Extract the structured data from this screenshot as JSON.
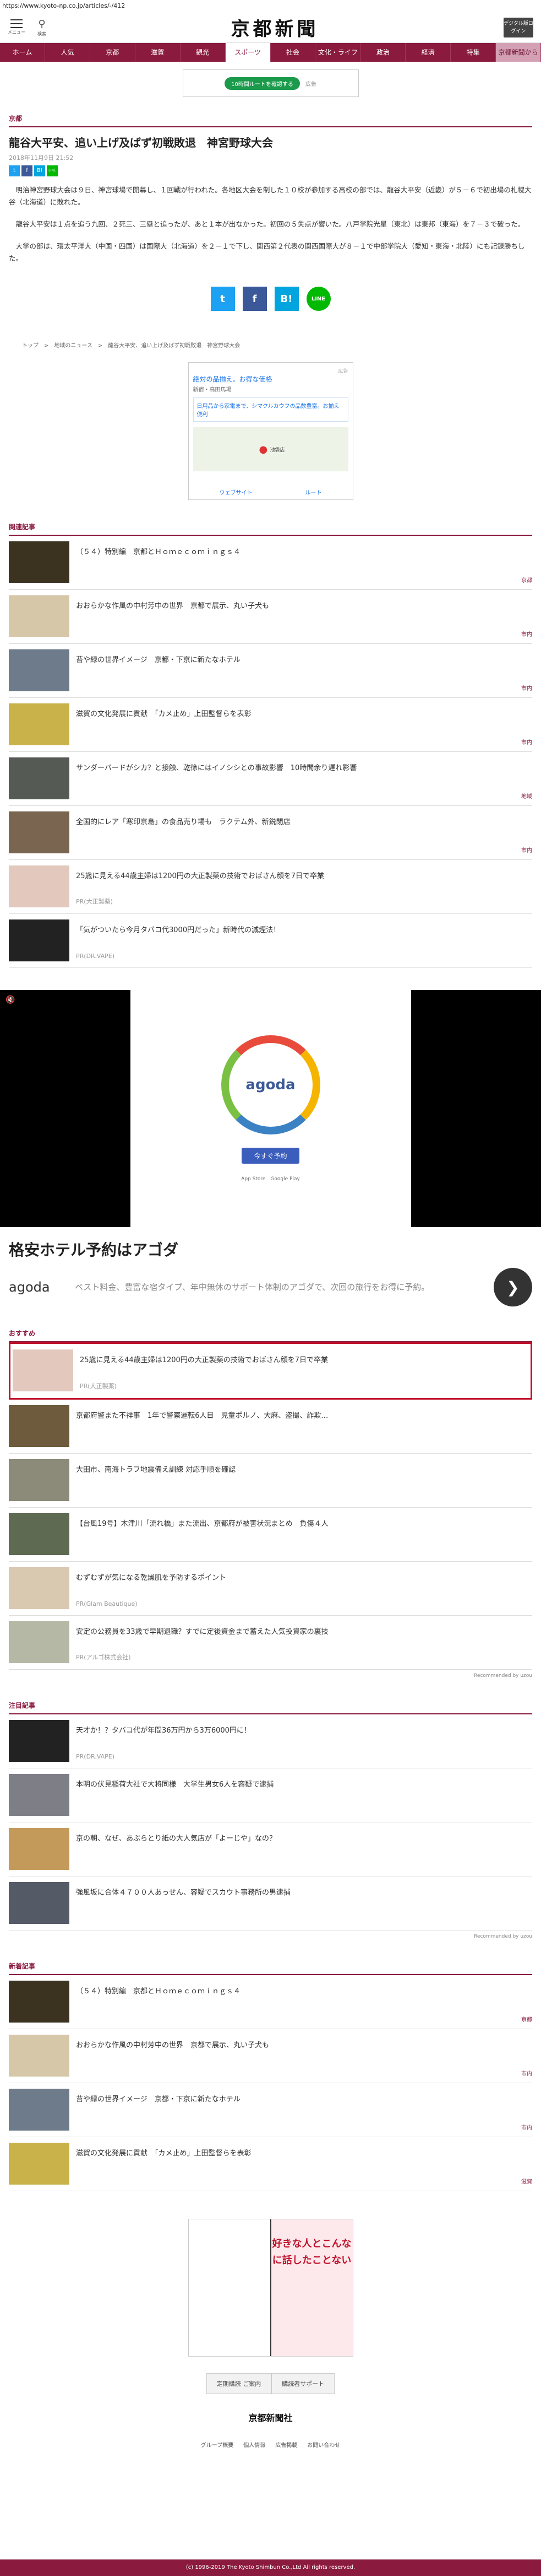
{
  "browser": {
    "url": "https://www.kyoto-np.co.jp/articles/-/412"
  },
  "header": {
    "menu_label": "メニュー",
    "search_label": "検索",
    "logo": "京都新聞",
    "digital_label": "デジタル版ログイン"
  },
  "nav": [
    "ホーム",
    "人気",
    "京都",
    "滋賀",
    "観光",
    "スポーツ",
    "社会",
    "文化・ライフ",
    "政治",
    "経済",
    "特集",
    "京都新聞から"
  ],
  "top_ad": {
    "pill": "10時間ルートを確認する",
    "label": "広告"
  },
  "article": {
    "category": "京都",
    "title": "龍谷大平安、追い上げ及ばず初戦敗退　神宮野球大会",
    "date": "2018年11月9日 21:52",
    "paragraphs": [
      "明治神宮野球大会は９日、神宮球場で開幕し、１回戦が行われた。各地区大会を制した１０校が参加する高校の部では、龍谷大平安（近畿）が５－６で初出場の札幌大谷（北海道）に敗れた。",
      "龍谷大平安は１点を追う九回、２死三、三塁と追ったが、あと１本が出なかった。初回の５失点が響いた。八戸学院光星（東北）は東邦（東海）を７－３で破った。",
      "大学の部は、環太平洋大（中国・四国）は国際大（北海道）を２－１で下し、関西第２代表の関西国際大が８－１で中部学院大（愛知・東海・北陸）にも記録勝ちした。"
    ],
    "share": {
      "twitter": "t",
      "facebook": "f",
      "hatena": "B!",
      "line": "LINE"
    },
    "breadcrumb": "トップ　>　地域のニュース　>　龍谷大平安、追い上げ及ばず初戦敗退　神宮野球大会"
  },
  "map_ad": {
    "label": "広告",
    "title": "絶対の品揃え。お得な価格",
    "sub": "新宿・高田馬場",
    "body": "日用品から家電まで、シマクルカウフの品数豊富。お揃え便利",
    "pin_label": "池袋店",
    "route": "ルート",
    "website": "ウェブサイト"
  },
  "related": {
    "title": "関連記事",
    "items": [
      {
        "title": "（５４）特別編　京都とＨｏｍｅｃｏｍｉｎｇｓ４",
        "tag": "京都"
      },
      {
        "title": "おおらかな作風の中村芳中の世界　京都で展示、丸い子犬も",
        "tag": "市内"
      },
      {
        "title": "苔や緑の世界イメージ　京都・下京に新たなホテル",
        "tag": "市内"
      },
      {
        "title": "滋賀の文化発展に貢献　「カメ止め」上田監督らを表彰",
        "tag": "市内"
      },
      {
        "title": "サンダーバードがシカ？と接触、乾徐にはイノシシとの事故影響　10時間余り遅れ影響",
        "tag": "地域"
      },
      {
        "title": "全国的にレア「寒印京島」の食品売り場も　ラクテム外、新鋭閉店",
        "tag": "市内"
      },
      {
        "title": "25歳に見える44歳主婦は1200円の大正製薬の技術でおばさん顔を7日で卒業",
        "sponsor": "PR(大正製薬)"
      },
      {
        "title": "「気がついたら今月タバコ代3000円だった」新時代の減煙法！",
        "sponsor": "PR(DR.VAPE)"
      }
    ]
  },
  "video_ad": {
    "brand": "agoda",
    "cta": "今すぐ予約",
    "stores": "App Store　Google Play",
    "headline": "格安ホテル予約はアゴダ",
    "description": "ベスト料金、豊富な宿タイプ、年中無休のサポート体制のアゴダで、次回の旅行をお得に予約。"
  },
  "recommend": {
    "title": "おすすめ",
    "items": [
      {
        "title": "25歳に見える44歳主婦は1200円の大正製薬の技術でおばさん顔を7日で卒業",
        "sponsor": "PR(大正製薬)"
      },
      {
        "title": "京都府警また不祥事　1年で警察運転6人目　児童ポルノ、大麻、盗撮、詐欺…",
        "tag": ""
      },
      {
        "title": "大田市、南海トラフ地震備え訓練 対応手順を確認",
        "tag": ""
      },
      {
        "title": "【台風19号】木津川「流れ橋」また流出、京都府が被害状況まとめ　負傷４人",
        "tag": ""
      },
      {
        "title": "むずむずが気になる乾燥肌を予防するポイント",
        "sponsor": "PR(Glam Beautique)"
      },
      {
        "title": "安定の公務員を33歳で早期退職？すでに定後資金まで蓄えた人気投資家の裏技",
        "sponsor": "PR(アルゴ株式会社)"
      }
    ],
    "recommended_by": "Recommended by uzou"
  },
  "attention": {
    "title": "注目記事",
    "items": [
      {
        "title": "天才か！？タバコ代が年間36万円から3万6000円に！",
        "sponsor": "PR(DR.VAPE)"
      },
      {
        "title": "本明の伏見稲荷大社で大将同様　大学生男女6人を容疑で逮捕",
        "tag": ""
      },
      {
        "title": "京の朝、なぜ、あぶらとり紙の大人気店が「よーじや」なの？",
        "tag": ""
      },
      {
        "title": "強風坂に合体４７００人あっせん、容疑でスカウト事務所の男逮捕",
        "tag": ""
      }
    ],
    "recommended_by": "Recommended by uzou"
  },
  "latest": {
    "title": "新着記事",
    "items": [
      {
        "title": "（５４）特別編　京都とＨｏｍｅｃｏｍｉｎｇｓ４",
        "tag": "京都"
      },
      {
        "title": "おおらかな作風の中村芳中の世界　京都で展示、丸い子犬も",
        "tag": "市内"
      },
      {
        "title": "苔や緑の世界イメージ　京都・下京に新たなホテル",
        "tag": "市内"
      },
      {
        "title": "滋賀の文化発展に貢献　「カメ止め」上田監督らを表彰",
        "tag": "滋賀"
      }
    ]
  },
  "footer": {
    "ad_text": "好きな人とこんなに話したことない",
    "subscribe": "定期購読 ご案内",
    "support": "購読者サポート",
    "logo": "京都新聞社",
    "links": [
      "グループ概要",
      "個人情報",
      "広告掲載",
      "お問い合わせ"
    ],
    "copyright": "(c) 1996-2019 The Kyoto Shimbun Co.,Ltd All rights reserved."
  },
  "colors": {
    "brand": "#8a1a3e",
    "highlight_border": "#c0102a",
    "twitter": "#1da1f2",
    "facebook": "#3b5998",
    "hatena": "#00a4de",
    "line": "#00b900"
  }
}
